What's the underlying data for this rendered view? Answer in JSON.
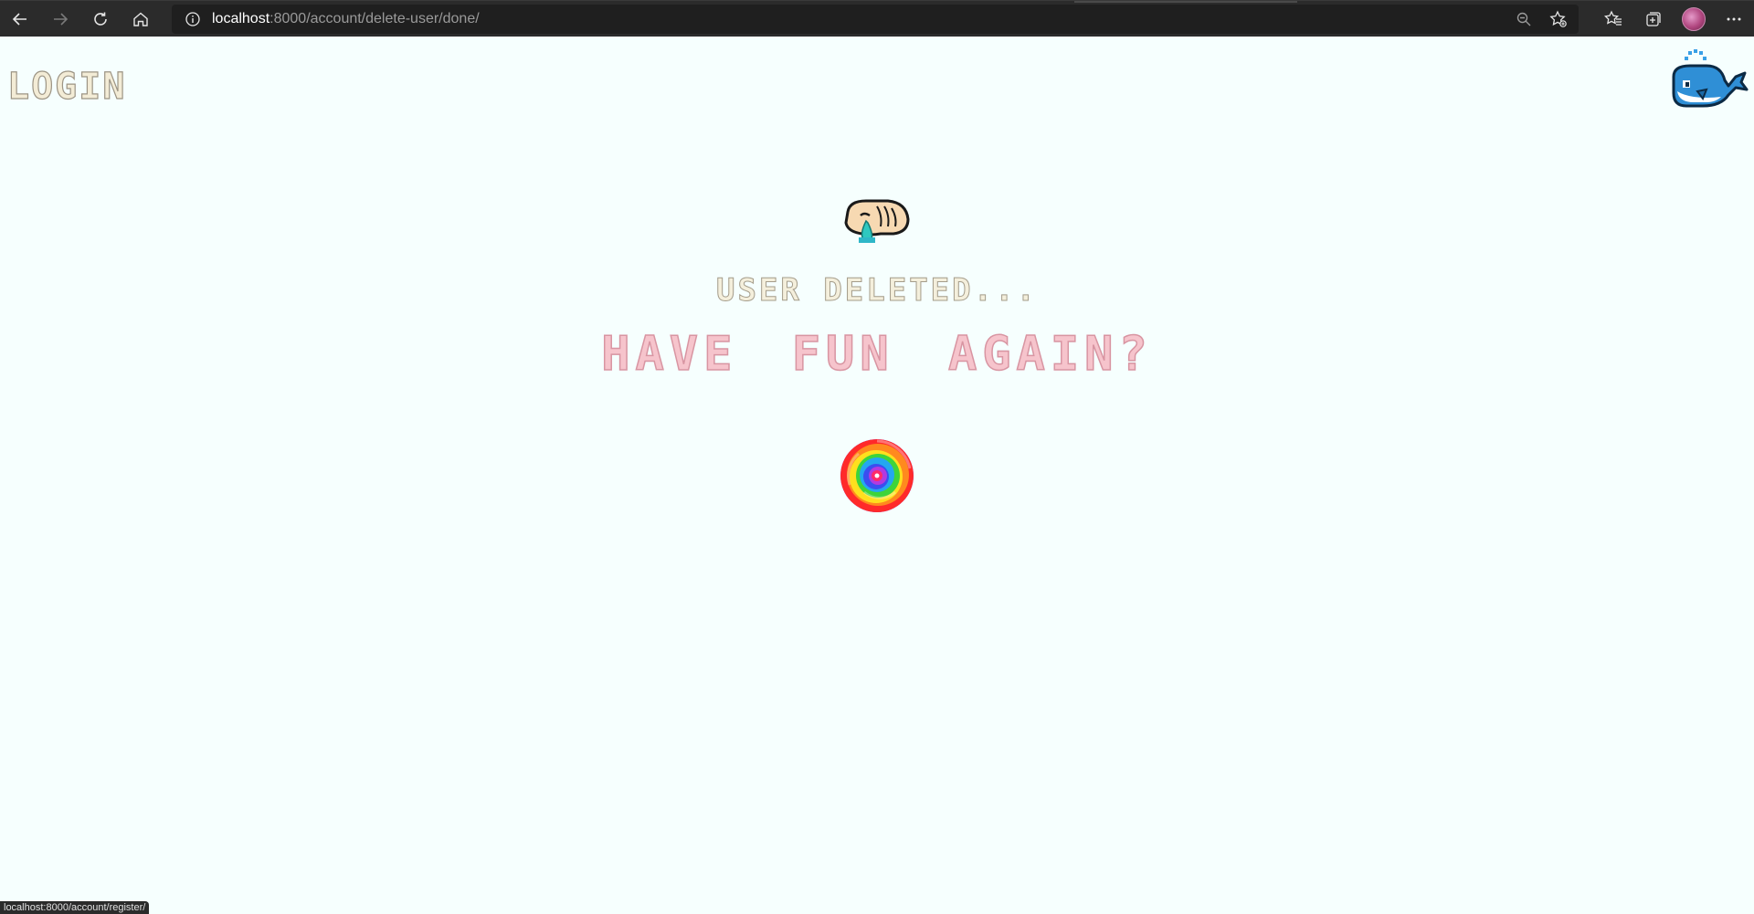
{
  "browser": {
    "url_host": "localhost",
    "url_path": ":8000/account/delete-user/done/",
    "status_url": "localhost:8000/account/register/",
    "icons": {
      "back": "back-arrow-icon",
      "forward": "forward-arrow-icon",
      "refresh": "refresh-icon",
      "home": "home-icon",
      "site_info": "info-icon",
      "zoom": "zoom-out-icon",
      "add_favorite": "add-favorite-icon",
      "favorites": "favorites-icon",
      "collections": "collections-icon",
      "profile": "profile-avatar",
      "menu": "more-menu-icon"
    }
  },
  "page": {
    "login_label": "LOGIN",
    "deleted_message": "USER DELETED...",
    "fun_message": "HAVE FUN AGAIN?",
    "images": {
      "logo": "whale-icon",
      "sad_face": "crying-face-icon",
      "spiral": "rainbow-spiral-icon"
    },
    "colors": {
      "background": "#f6fffe",
      "deleted_text": "#f4efdc",
      "fun_text": "#f6c4cc",
      "whale": "#2f8fd6"
    }
  }
}
